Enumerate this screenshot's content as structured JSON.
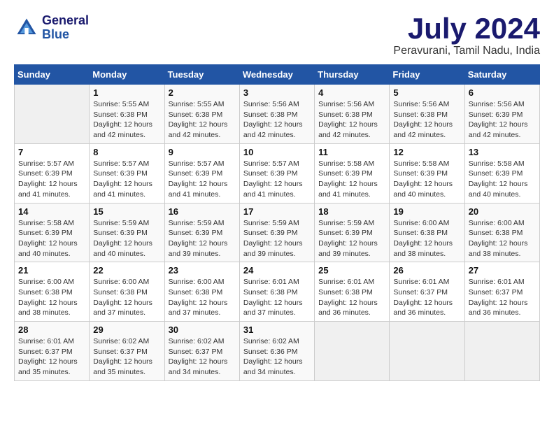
{
  "header": {
    "logo_line1": "General",
    "logo_line2": "Blue",
    "month_year": "July 2024",
    "location": "Peravurani, Tamil Nadu, India"
  },
  "calendar": {
    "days_of_week": [
      "Sunday",
      "Monday",
      "Tuesday",
      "Wednesday",
      "Thursday",
      "Friday",
      "Saturday"
    ],
    "weeks": [
      [
        {
          "day": "",
          "info": ""
        },
        {
          "day": "1",
          "info": "Sunrise: 5:55 AM\nSunset: 6:38 PM\nDaylight: 12 hours\nand 42 minutes."
        },
        {
          "day": "2",
          "info": "Sunrise: 5:55 AM\nSunset: 6:38 PM\nDaylight: 12 hours\nand 42 minutes."
        },
        {
          "day": "3",
          "info": "Sunrise: 5:56 AM\nSunset: 6:38 PM\nDaylight: 12 hours\nand 42 minutes."
        },
        {
          "day": "4",
          "info": "Sunrise: 5:56 AM\nSunset: 6:38 PM\nDaylight: 12 hours\nand 42 minutes."
        },
        {
          "day": "5",
          "info": "Sunrise: 5:56 AM\nSunset: 6:38 PM\nDaylight: 12 hours\nand 42 minutes."
        },
        {
          "day": "6",
          "info": "Sunrise: 5:56 AM\nSunset: 6:39 PM\nDaylight: 12 hours\nand 42 minutes."
        }
      ],
      [
        {
          "day": "7",
          "info": "Sunrise: 5:57 AM\nSunset: 6:39 PM\nDaylight: 12 hours\nand 41 minutes."
        },
        {
          "day": "8",
          "info": "Sunrise: 5:57 AM\nSunset: 6:39 PM\nDaylight: 12 hours\nand 41 minutes."
        },
        {
          "day": "9",
          "info": "Sunrise: 5:57 AM\nSunset: 6:39 PM\nDaylight: 12 hours\nand 41 minutes."
        },
        {
          "day": "10",
          "info": "Sunrise: 5:57 AM\nSunset: 6:39 PM\nDaylight: 12 hours\nand 41 minutes."
        },
        {
          "day": "11",
          "info": "Sunrise: 5:58 AM\nSunset: 6:39 PM\nDaylight: 12 hours\nand 41 minutes."
        },
        {
          "day": "12",
          "info": "Sunrise: 5:58 AM\nSunset: 6:39 PM\nDaylight: 12 hours\nand 40 minutes."
        },
        {
          "day": "13",
          "info": "Sunrise: 5:58 AM\nSunset: 6:39 PM\nDaylight: 12 hours\nand 40 minutes."
        }
      ],
      [
        {
          "day": "14",
          "info": "Sunrise: 5:58 AM\nSunset: 6:39 PM\nDaylight: 12 hours\nand 40 minutes."
        },
        {
          "day": "15",
          "info": "Sunrise: 5:59 AM\nSunset: 6:39 PM\nDaylight: 12 hours\nand 40 minutes."
        },
        {
          "day": "16",
          "info": "Sunrise: 5:59 AM\nSunset: 6:39 PM\nDaylight: 12 hours\nand 39 minutes."
        },
        {
          "day": "17",
          "info": "Sunrise: 5:59 AM\nSunset: 6:39 PM\nDaylight: 12 hours\nand 39 minutes."
        },
        {
          "day": "18",
          "info": "Sunrise: 5:59 AM\nSunset: 6:39 PM\nDaylight: 12 hours\nand 39 minutes."
        },
        {
          "day": "19",
          "info": "Sunrise: 6:00 AM\nSunset: 6:38 PM\nDaylight: 12 hours\nand 38 minutes."
        },
        {
          "day": "20",
          "info": "Sunrise: 6:00 AM\nSunset: 6:38 PM\nDaylight: 12 hours\nand 38 minutes."
        }
      ],
      [
        {
          "day": "21",
          "info": "Sunrise: 6:00 AM\nSunset: 6:38 PM\nDaylight: 12 hours\nand 38 minutes."
        },
        {
          "day": "22",
          "info": "Sunrise: 6:00 AM\nSunset: 6:38 PM\nDaylight: 12 hours\nand 37 minutes."
        },
        {
          "day": "23",
          "info": "Sunrise: 6:00 AM\nSunset: 6:38 PM\nDaylight: 12 hours\nand 37 minutes."
        },
        {
          "day": "24",
          "info": "Sunrise: 6:01 AM\nSunset: 6:38 PM\nDaylight: 12 hours\nand 37 minutes."
        },
        {
          "day": "25",
          "info": "Sunrise: 6:01 AM\nSunset: 6:38 PM\nDaylight: 12 hours\nand 36 minutes."
        },
        {
          "day": "26",
          "info": "Sunrise: 6:01 AM\nSunset: 6:37 PM\nDaylight: 12 hours\nand 36 minutes."
        },
        {
          "day": "27",
          "info": "Sunrise: 6:01 AM\nSunset: 6:37 PM\nDaylight: 12 hours\nand 36 minutes."
        }
      ],
      [
        {
          "day": "28",
          "info": "Sunrise: 6:01 AM\nSunset: 6:37 PM\nDaylight: 12 hours\nand 35 minutes."
        },
        {
          "day": "29",
          "info": "Sunrise: 6:02 AM\nSunset: 6:37 PM\nDaylight: 12 hours\nand 35 minutes."
        },
        {
          "day": "30",
          "info": "Sunrise: 6:02 AM\nSunset: 6:37 PM\nDaylight: 12 hours\nand 34 minutes."
        },
        {
          "day": "31",
          "info": "Sunrise: 6:02 AM\nSunset: 6:36 PM\nDaylight: 12 hours\nand 34 minutes."
        },
        {
          "day": "",
          "info": ""
        },
        {
          "day": "",
          "info": ""
        },
        {
          "day": "",
          "info": ""
        }
      ]
    ]
  }
}
